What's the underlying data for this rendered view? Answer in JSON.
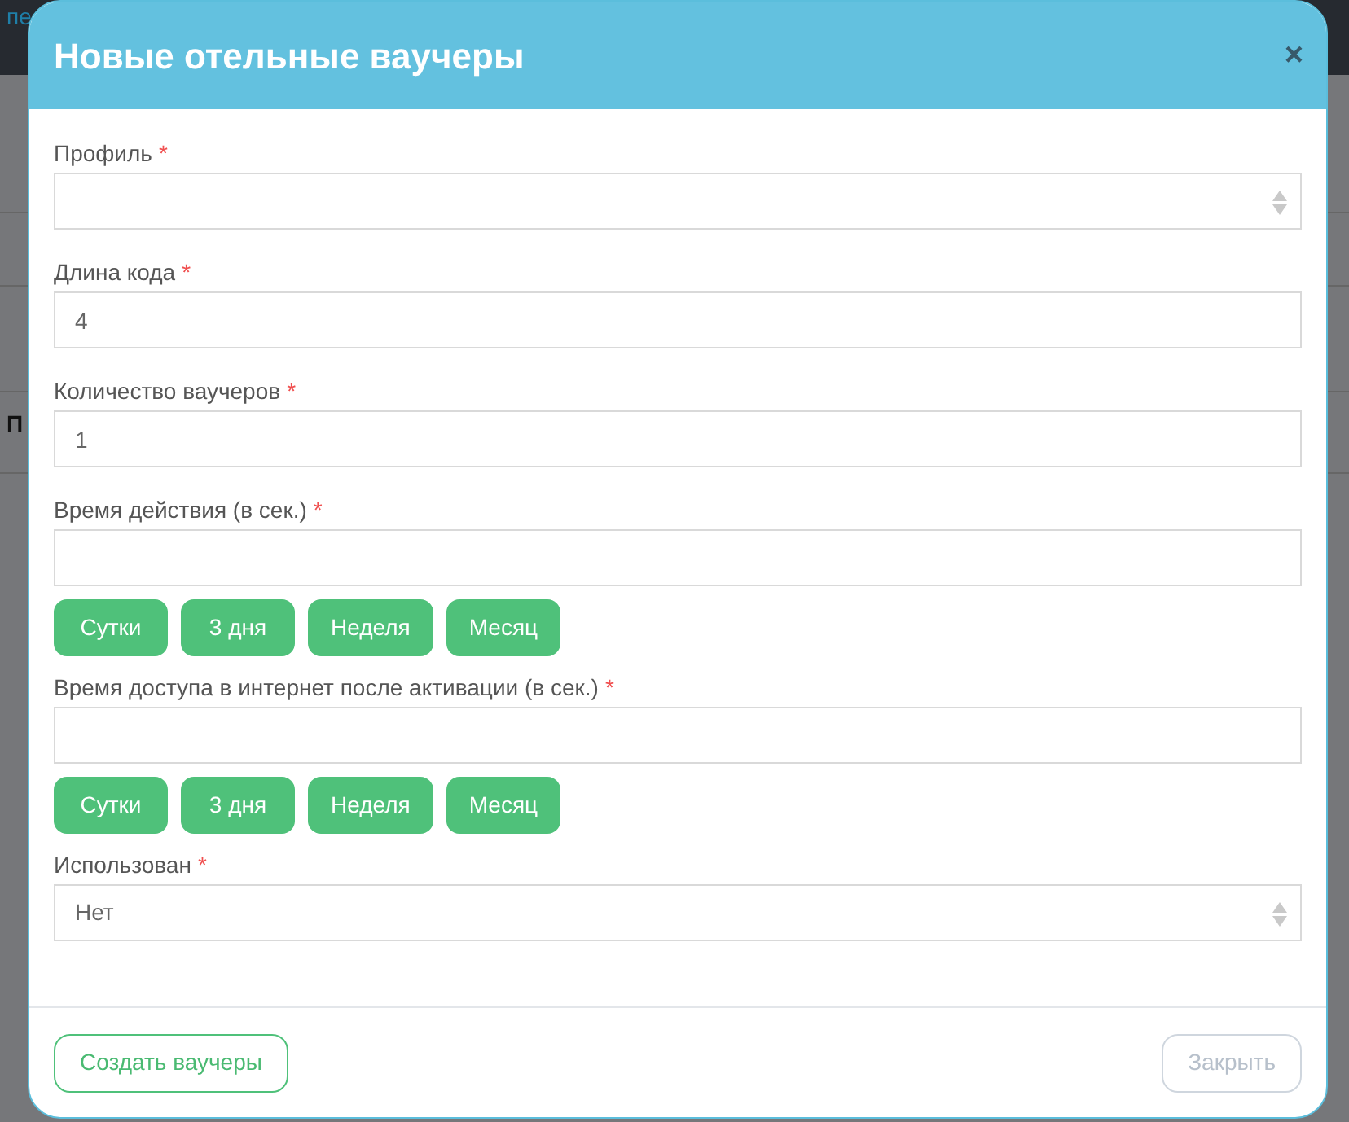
{
  "background": {
    "link_fragment": "пе",
    "heading_fragment": "П"
  },
  "modal": {
    "title": "Новые отельные ваучеры",
    "close": "×",
    "fields": [
      {
        "kind": "select",
        "label": "Профиль",
        "required_mark": "*"
      },
      {
        "kind": "input",
        "label": "Длина кода",
        "required_mark": "*",
        "value": "4"
      },
      {
        "kind": "input",
        "label": "Количество ваучеров",
        "required_mark": "*",
        "value": "1"
      },
      {
        "kind": "presets",
        "label": "Время действия (в сек.)",
        "required_mark": "*",
        "presets": [
          "Сутки",
          "3 дня",
          "Неделя",
          "Месяц"
        ]
      },
      {
        "kind": "presets",
        "label": "Время доступа в интернет после активации (в сек.)",
        "required_mark": "*",
        "presets": [
          "Сутки",
          "3 дня",
          "Неделя",
          "Месяц"
        ]
      },
      {
        "kind": "select",
        "label": "Использован",
        "required_mark": "*",
        "value": "Нет"
      }
    ],
    "footer": {
      "submit": "Создать ваучеры",
      "close": {
        "label": "Закрыть",
        "disabled": true
      }
    }
  }
}
